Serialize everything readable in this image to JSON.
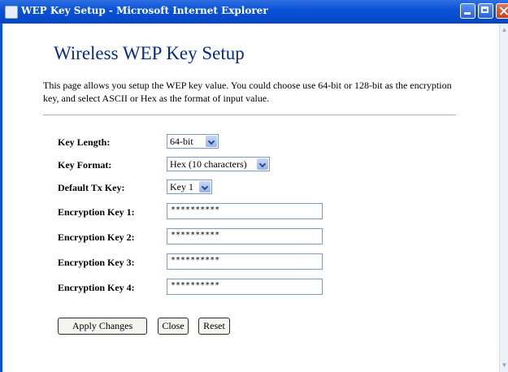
{
  "window": {
    "title": "WEP Key Setup - Microsoft Internet Explorer"
  },
  "page": {
    "heading": "Wireless WEP Key Setup",
    "description": "This page allows you setup the WEP key value. You could choose use 64-bit or 128-bit as the encryption key, and select ASCII or Hex as the format of input value."
  },
  "form": {
    "key_length": {
      "label": "Key Length:",
      "value": "64-bit"
    },
    "key_format": {
      "label": "Key Format:",
      "value": "Hex (10 characters)"
    },
    "default_tx_key": {
      "label": "Default Tx Key:",
      "value": "Key 1"
    },
    "keys": [
      {
        "label": "Encryption Key 1:",
        "value": "**********"
      },
      {
        "label": "Encryption Key 2:",
        "value": "**********"
      },
      {
        "label": "Encryption Key 3:",
        "value": "**********"
      },
      {
        "label": "Encryption Key 4:",
        "value": "**********"
      }
    ]
  },
  "buttons": {
    "apply": "Apply Changes",
    "close": "Close",
    "reset": "Reset"
  },
  "colors": {
    "titlebar": "#0a52d8",
    "heading": "#0a2a8a"
  },
  "icons": {
    "scroll_up": "▲",
    "scroll_down": "▼"
  }
}
